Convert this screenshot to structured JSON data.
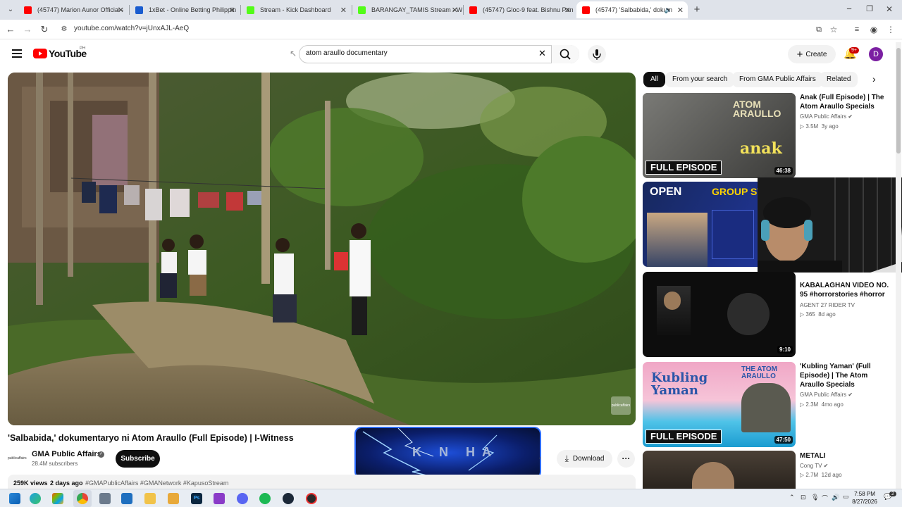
{
  "browser": {
    "tabs": [
      {
        "title": "(45747) Marion Aunor Official -",
        "color": "#ff0000"
      },
      {
        "title": "1xBet - Online Betting Philippin",
        "color": "#1a5ccf"
      },
      {
        "title": "Stream - Kick Dashboard",
        "color": "#53fc18"
      },
      {
        "title": "BARANGAY_TAMIS Stream - Wa",
        "color": "#53fc18"
      },
      {
        "title": "(45747) Gloc-9 feat. Bishnu Pan",
        "color": "#ff0000"
      },
      {
        "title": "(45747) 'Salbabida,' dokum",
        "color": "#ff0000"
      }
    ],
    "url": "youtube.com/watch?v=jUnxAJL-AeQ"
  },
  "youtube": {
    "logo_text": "YouTube",
    "region": "PH",
    "search_value": "atom araullo documentary",
    "create_label": "Create",
    "notif_badge": "9+",
    "avatar_letter": "D"
  },
  "video": {
    "title": "'Salbabida,' dokumentaryo ni Atom Araullo (Full Episode) | I-Witness",
    "channel": "GMA Public Affairs",
    "subscribers": "28.4M subscribers",
    "subscribe_label": "Subscribe",
    "download_label": "Download",
    "views": "259K views",
    "age": "2 days ago",
    "hashtags": "#GMAPublicAffairs #GMANetwork #KapusoStream",
    "watermark": "publicaffairs",
    "overlay_text": "K N  HA"
  },
  "chips": [
    "All",
    "From your search",
    "From GMA Public Affairs",
    "Related"
  ],
  "sidebar": [
    {
      "title": "Anak (Full Episode) | The Atom Araullo Specials",
      "channel": "GMA Public Affairs",
      "verified": true,
      "views": "3.5M",
      "age": "3y ago",
      "duration": "46:38",
      "label": "FULL EPISODE",
      "overlay": "anak",
      "brand": "ATOM ARAULLO"
    },
    {
      "title": "",
      "channel": "",
      "verified": false,
      "views": "",
      "age": "",
      "duration": "",
      "label": "",
      "overlay": "GROUP STAG",
      "brand": "OPEN"
    },
    {
      "title": "KABALAGHAN VIDEO NO. 95 #horrorstories #horror",
      "channel": "AGENT 27 RIDER TV",
      "verified": false,
      "views": "365",
      "age": "8d ago",
      "duration": "9:10",
      "label": "",
      "overlay": "",
      "brand": ""
    },
    {
      "title": "'Kubling Yaman' (Full Episode) | The Atom Araullo Specials",
      "channel": "GMA Public Affairs",
      "verified": true,
      "views": "2.3M",
      "age": "4mo ago",
      "duration": "47:50",
      "label": "FULL EPISODE",
      "overlay": "Kubling Yaman",
      "brand": "THE ATOM ARAULLO"
    },
    {
      "title": "METALI",
      "channel": "Cong TV",
      "verified": true,
      "views": "2.7M",
      "age": "12d ago",
      "duration": "",
      "label": "",
      "overlay": "",
      "brand": ""
    }
  ],
  "taskbar": {
    "time": "7:58 PM",
    "date": "8/27/2026",
    "notif_count": "2"
  }
}
